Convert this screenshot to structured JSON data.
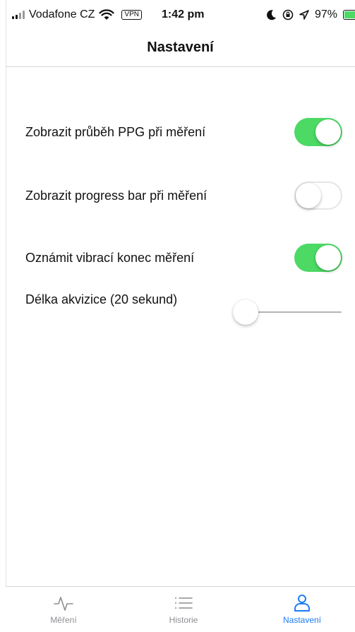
{
  "status_bar": {
    "carrier": "Vodafone CZ",
    "vpn": "VPN",
    "time": "1:42 pm",
    "battery": "97%",
    "battery_level": 0.97,
    "icons": [
      "signal-icon",
      "wifi-icon",
      "moon-icon",
      "orientation-lock-icon",
      "location-icon",
      "battery-icon",
      "charging-icon"
    ]
  },
  "navbar": {
    "title": "Nastavení"
  },
  "settings": {
    "items": [
      {
        "label": "Zobrazit průběh PPG při měření",
        "enabled": true
      },
      {
        "label": "Zobrazit progress bar při měření",
        "enabled": false
      },
      {
        "label": "Oznámit vibrací konec měření",
        "enabled": true
      }
    ],
    "acquisition": {
      "label": "Délka akvizice (20 sekund)",
      "value_seconds": 20,
      "slider_fraction": 0.0
    }
  },
  "tabbar": {
    "tabs": [
      {
        "label": "Měření",
        "icon": "pulse-icon",
        "active": false
      },
      {
        "label": "Historie",
        "icon": "list-icon",
        "active": false
      },
      {
        "label": "Nastavení",
        "icon": "person-icon",
        "active": true
      }
    ]
  },
  "colors": {
    "accent": "#1d7bf5",
    "toggle_on": "#4cd964",
    "inactive_tab": "#8e8e93"
  }
}
